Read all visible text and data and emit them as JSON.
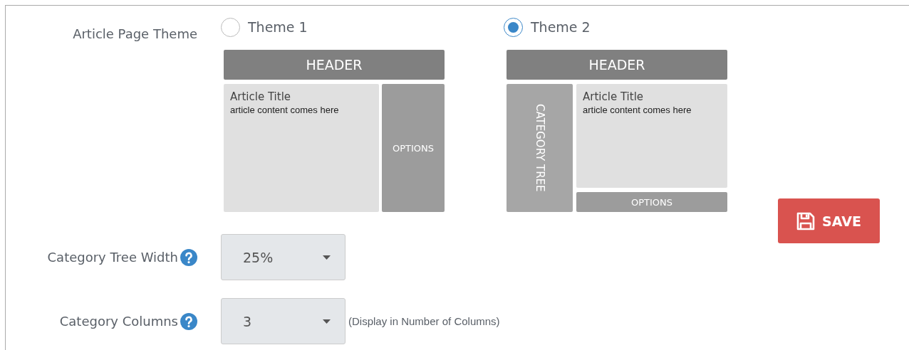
{
  "theme_setting": {
    "label": "Article Page Theme",
    "options": [
      {
        "label": "Theme 1",
        "selected": false,
        "kind": "side",
        "preview": {
          "header": "HEADER",
          "article_title": "Article Title",
          "article_text": "article content comes here",
          "options": "OPTIONS"
        }
      },
      {
        "label": "Theme 2",
        "selected": true,
        "kind": "tree",
        "preview": {
          "header": "HEADER",
          "category_tree": "CATEGORY TREE",
          "article_title": "Article Title",
          "article_text": "article content comes here",
          "options": "OPTIONS"
        }
      }
    ]
  },
  "save_button": {
    "label": "SAVE"
  },
  "fields": [
    {
      "label": "Category Tree Width",
      "value": "25%"
    },
    {
      "label": "Category Columns",
      "value": "3",
      "hint": "(Display in Number of Columns)"
    }
  ]
}
